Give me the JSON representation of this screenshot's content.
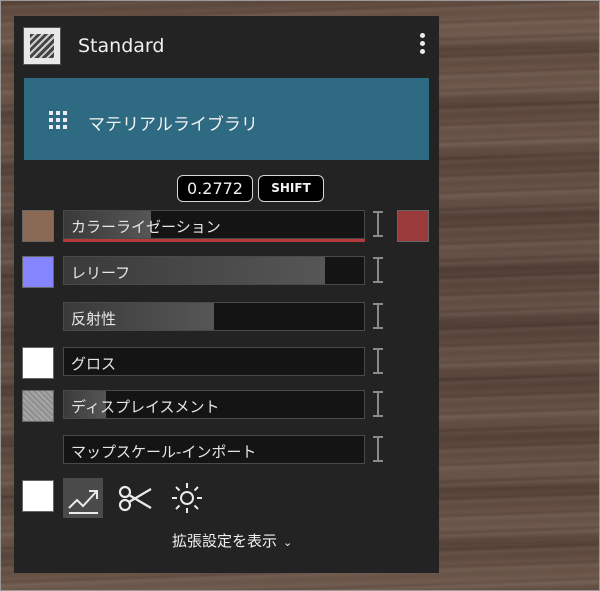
{
  "material": {
    "name": "Standard",
    "thumbnail_icon": "hatched-material-icon",
    "menu_icon": "kebab-menu-icon"
  },
  "library": {
    "label": "マテリアルライブラリ",
    "icon": "grid-icon",
    "color": "#2f6a83"
  },
  "value_readout": {
    "value": "0.2772",
    "shift_label": "SHIFT"
  },
  "properties": [
    {
      "label": "カラーライゼーション",
      "swatch": "#8a6a55",
      "fill": 0.29,
      "has_right_swatch": true,
      "right_swatch": "#9b3a3a",
      "underline": "#b23a3a"
    },
    {
      "label": "レリーフ",
      "swatch": "#8585ff",
      "fill": 0.87
    },
    {
      "label": "反射性",
      "swatch": null,
      "fill": 0.5
    },
    {
      "label": "グロス",
      "swatch": "#ffffff",
      "fill": 0.0
    },
    {
      "label": "ディスプレイスメント",
      "swatch": "#9a9a9a",
      "fill": 0.14
    },
    {
      "label": "マップスケール-インポート",
      "swatch": null,
      "fill": 0.0
    }
  ],
  "toolbar": {
    "icons": [
      "white-swatch",
      "uv-mapping-icon",
      "scissors-icon",
      "sun-icon"
    ]
  },
  "advanced": {
    "label": "拡張設定を表示",
    "icon": "chevron-down-icon"
  }
}
